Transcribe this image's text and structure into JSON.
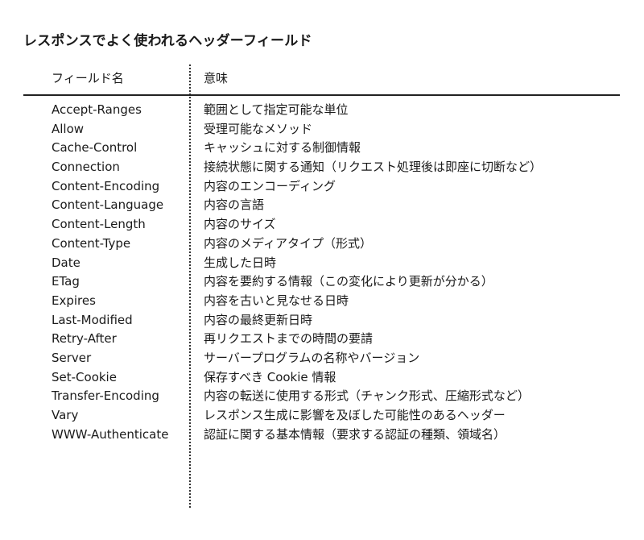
{
  "title": "レスポンスでよく使われるヘッダーフィールド",
  "columns": {
    "field": "フィールド名",
    "meaning": "意味"
  },
  "rows": [
    {
      "field": "Accept-Ranges",
      "meaning": "範囲として指定可能な単位"
    },
    {
      "field": "Allow",
      "meaning": "受理可能なメソッド"
    },
    {
      "field": "Cache-Control",
      "meaning": "キャッシュに対する制御情報"
    },
    {
      "field": "Connection",
      "meaning": "接続状態に関する通知（リクエスト処理後は即座に切断など）"
    },
    {
      "field": "Content-Encoding",
      "meaning": "内容のエンコーディング"
    },
    {
      "field": "Content-Language",
      "meaning": "内容の言語"
    },
    {
      "field": "Content-Length",
      "meaning": "内容のサイズ"
    },
    {
      "field": "Content-Type",
      "meaning": "内容のメディアタイプ（形式）"
    },
    {
      "field": "Date",
      "meaning": "生成した日時"
    },
    {
      "field": "ETag",
      "meaning": "内容を要約する情報（この変化により更新が分かる）"
    },
    {
      "field": "Expires",
      "meaning": "内容を古いと見なせる日時"
    },
    {
      "field": "Last-Modified",
      "meaning": "内容の最終更新日時"
    },
    {
      "field": "Retry-After",
      "meaning": "再リクエストまでの時間の要請"
    },
    {
      "field": "Server",
      "meaning": "サーバープログラムの名称やバージョン"
    },
    {
      "field": "Set-Cookie",
      "meaning": "保存すべき Cookie 情報"
    },
    {
      "field": "Transfer-Encoding",
      "meaning": "内容の転送に使用する形式（チャンク形式、圧縮形式など）"
    },
    {
      "field": "Vary",
      "meaning": "レスポンス生成に影響を及ぼした可能性のあるヘッダー"
    },
    {
      "field": "WWW-Authenticate",
      "meaning": "認証に関する基本情報（要求する認証の種類、領域名）"
    }
  ]
}
